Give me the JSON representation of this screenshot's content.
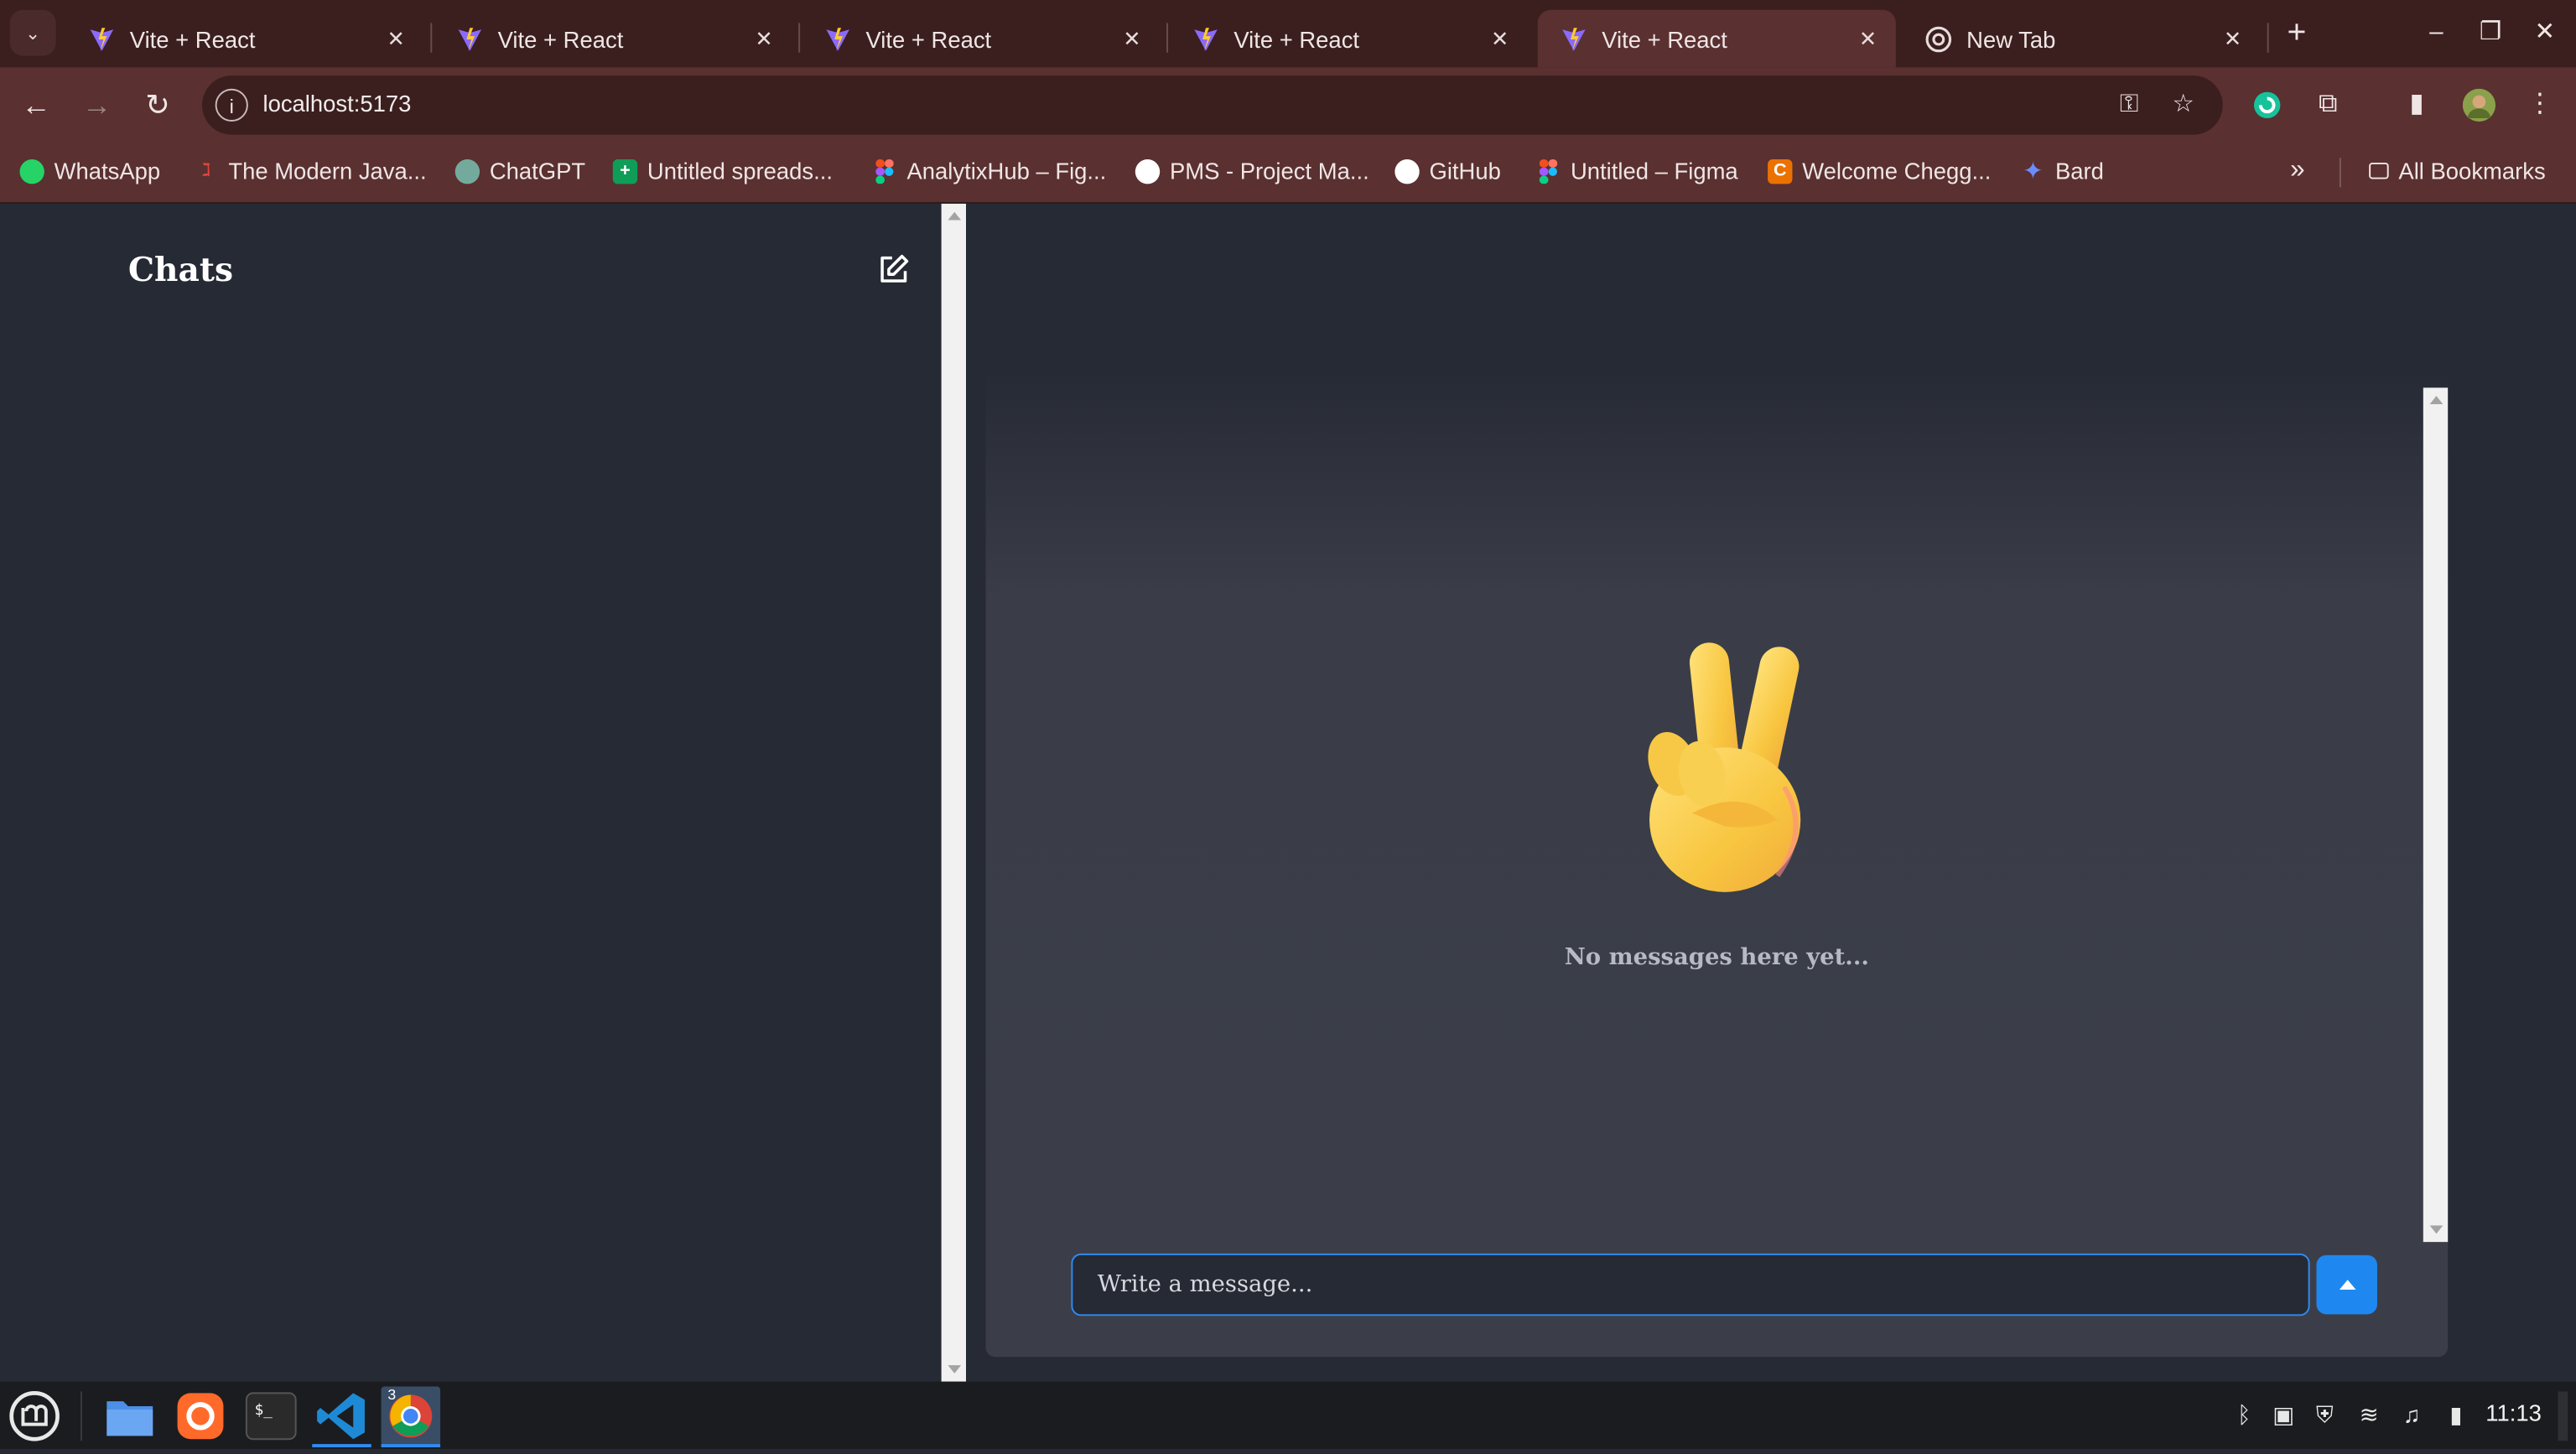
{
  "browser": {
    "tabs": [
      {
        "title": "Vite + React",
        "active": false,
        "icon": "vite-icon"
      },
      {
        "title": "Vite + React",
        "active": false,
        "icon": "vite-icon"
      },
      {
        "title": "Vite + React",
        "active": false,
        "icon": "vite-icon"
      },
      {
        "title": "Vite + React",
        "active": false,
        "icon": "vite-icon"
      },
      {
        "title": "Vite + React",
        "active": true,
        "icon": "vite-icon"
      },
      {
        "title": "New Tab",
        "active": false,
        "icon": "chrome-icon"
      }
    ],
    "tab_close_glyph": "✕",
    "new_tab_glyph": "+",
    "url": "localhost:5173",
    "bookmarks": [
      {
        "label": "WhatsApp",
        "icon": "whatsapp-icon",
        "color": "#25d366"
      },
      {
        "label": "The Modern Java...",
        "icon": "javascript-icon",
        "color": "#e0443e"
      },
      {
        "label": "ChatGPT",
        "icon": "chatgpt-icon",
        "color": "#74aa9c"
      },
      {
        "label": "Untitled spreads...",
        "icon": "sheets-icon",
        "color": "#0f9d58"
      },
      {
        "label": "AnalytixHub – Fig...",
        "icon": "figma-icon",
        "color": "#f24e1e"
      },
      {
        "label": "PMS - Project Ma...",
        "icon": "github-icon",
        "color": "#ffffff"
      },
      {
        "label": "GitHub",
        "icon": "github-icon",
        "color": "#ffffff"
      },
      {
        "label": "Untitled – Figma",
        "icon": "figma-icon",
        "color": "#a259ff"
      },
      {
        "label": "Welcome Chegg...",
        "icon": "chegg-icon",
        "color": "#eb7100"
      },
      {
        "label": "Bard",
        "icon": "bard-icon",
        "color": "#6b8cff"
      }
    ],
    "all_bookmarks": "All Bookmarks",
    "overflow_glyph": "»"
  },
  "app": {
    "sidebar_title": "Chats",
    "empty_state": "No messages here yet...",
    "input_placeholder": "Write a message...",
    "accent": "#1e88f0"
  },
  "taskbar": {
    "clock": "11:13",
    "chrome_badge": "3"
  }
}
